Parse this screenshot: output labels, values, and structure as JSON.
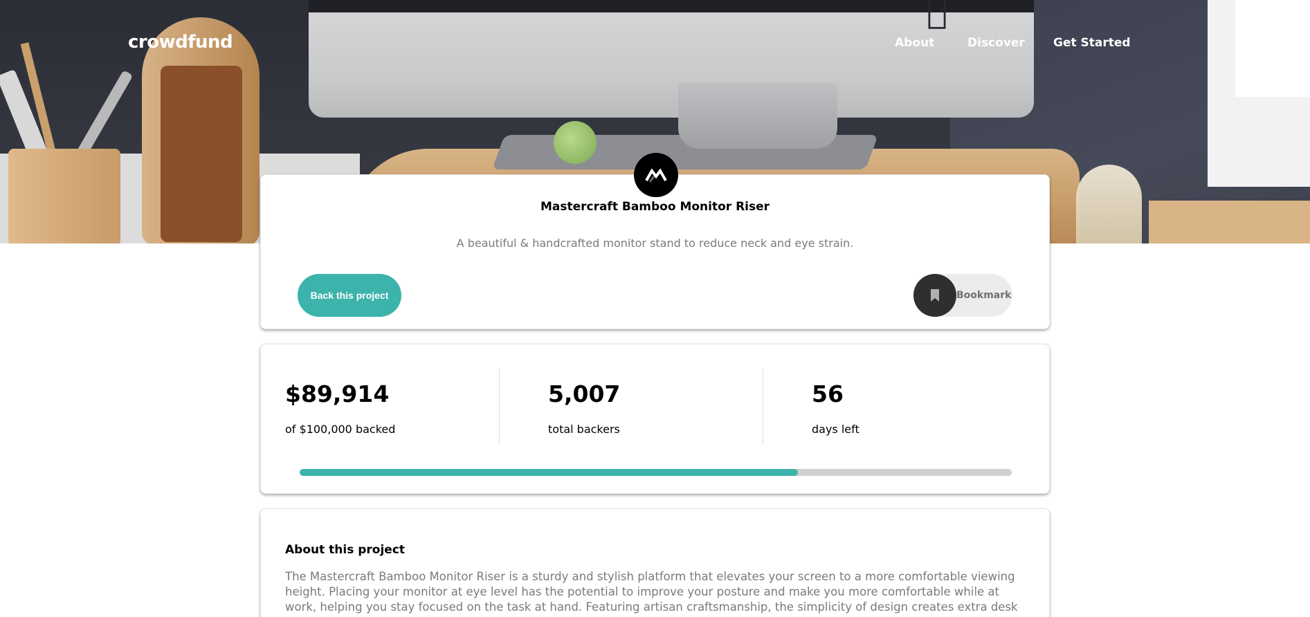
{
  "header": {
    "logo": "crowdfund",
    "nav": [
      {
        "label": "About"
      },
      {
        "label": "Discover"
      },
      {
        "label": "Get Started"
      }
    ]
  },
  "project": {
    "title": "Mastercraft Bamboo Monitor Riser",
    "subtitle": "A beautiful & handcrafted monitor stand to reduce neck and eye strain.",
    "back_label": "Back this project",
    "bookmark_label": "Bookmark"
  },
  "stats": {
    "backed_amount": "$89,914",
    "backed_label": "of $100,000 backed",
    "backers_count": "5,007",
    "backers_label": "total backers",
    "days_count": "56",
    "days_label": "days left",
    "progress_fraction": 0.7
  },
  "about": {
    "heading": "About this project",
    "body": "The Mastercraft Bamboo Monitor Riser is a sturdy and stylish platform that elevates your screen to a more comfortable viewing height. Placing your monitor at eye level has the potential to improve your posture and make you more comfortable while at work, helping you stay focused on the task at hand. Featuring artisan craftsmanship, the simplicity of design creates extra desk space below"
  },
  "colors": {
    "accent": "#3cb3ab",
    "dark": "#2f2f2f",
    "muted_text": "#7a7a7a"
  },
  "icons": {
    "brand": "mastercraft-logo-icon",
    "bookmark": "bookmark-icon"
  }
}
